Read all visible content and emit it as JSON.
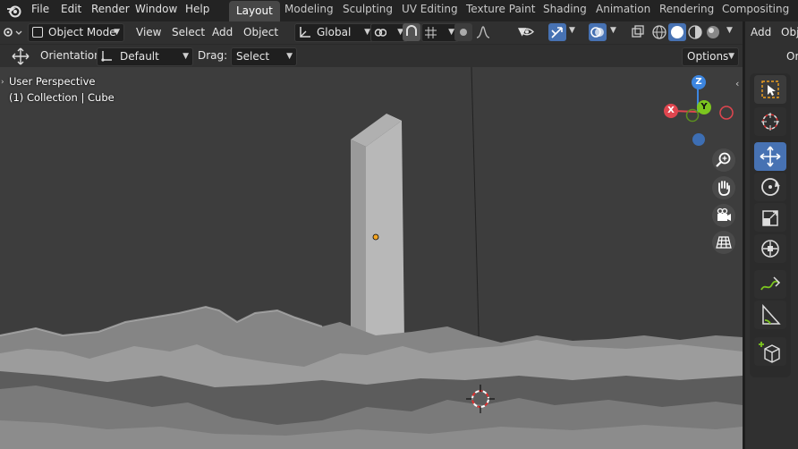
{
  "topbar": {
    "menus": [
      "File",
      "Edit",
      "Render",
      "Window",
      "Help"
    ],
    "workspaces": [
      "Layout",
      "Modeling",
      "Sculpting",
      "UV Editing",
      "Texture Paint",
      "Shading",
      "Animation",
      "Rendering",
      "Compositing"
    ],
    "active_workspace": "Layout"
  },
  "header": {
    "mode": "Object Mode",
    "menus": [
      "View",
      "Select",
      "Add",
      "Object"
    ],
    "transform_orientation": "Global"
  },
  "toolsettings": {
    "orientation_label": "Orientation:",
    "orientation_value": "Default",
    "drag_label": "Drag:",
    "drag_value": "Select Box",
    "options": "Options"
  },
  "viewport": {
    "perspective": "User Perspective",
    "context": "(1) Collection | Cube",
    "gizmo": {
      "x": "X",
      "y": "Y",
      "z": "Z"
    }
  },
  "rpanel": {
    "add": "Add",
    "object": "Obj",
    "orientation_short": "Ori"
  },
  "colors": {
    "accent": "#4772b3",
    "axis_x": "#e0464f",
    "axis_y": "#7cc61f",
    "axis_z": "#3d86e0"
  }
}
